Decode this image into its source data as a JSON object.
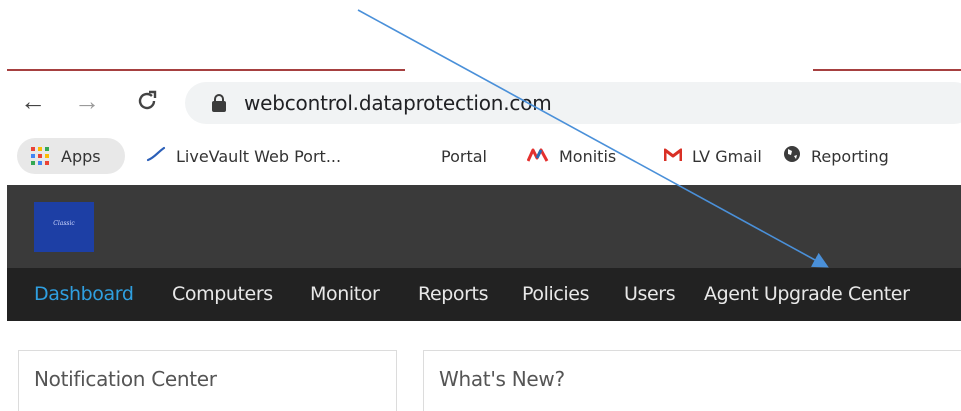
{
  "browser": {
    "url": "webcontrol.dataprotection.com",
    "bookmarks": [
      {
        "label": "Apps",
        "icon": "apps-grid-icon"
      },
      {
        "label": "LiveVault Web Port...",
        "icon": "livevault-icon"
      },
      {
        "label": "Portal",
        "icon": ""
      },
      {
        "label": "Monitis",
        "icon": "monitis-icon"
      },
      {
        "label": "LV Gmail",
        "icon": "gmail-icon"
      },
      {
        "label": "Reporting",
        "icon": "globe-icon"
      }
    ]
  },
  "app": {
    "logo_text": "Classic",
    "menu": [
      {
        "label": "Dashboard",
        "active": true
      },
      {
        "label": "Computers"
      },
      {
        "label": "Monitor"
      },
      {
        "label": "Reports"
      },
      {
        "label": "Policies"
      },
      {
        "label": "Users"
      },
      {
        "label": "Agent Upgrade Center"
      }
    ]
  },
  "panels": {
    "notification_title": "Notification Center",
    "news_title": "What's New?"
  },
  "colors": {
    "active_menu": "#2f9fe0",
    "header_bg": "#3a3a3a",
    "menu_bg": "#222222",
    "arrow": "#4a90d9",
    "logo_bg": "#1d3fa5"
  }
}
